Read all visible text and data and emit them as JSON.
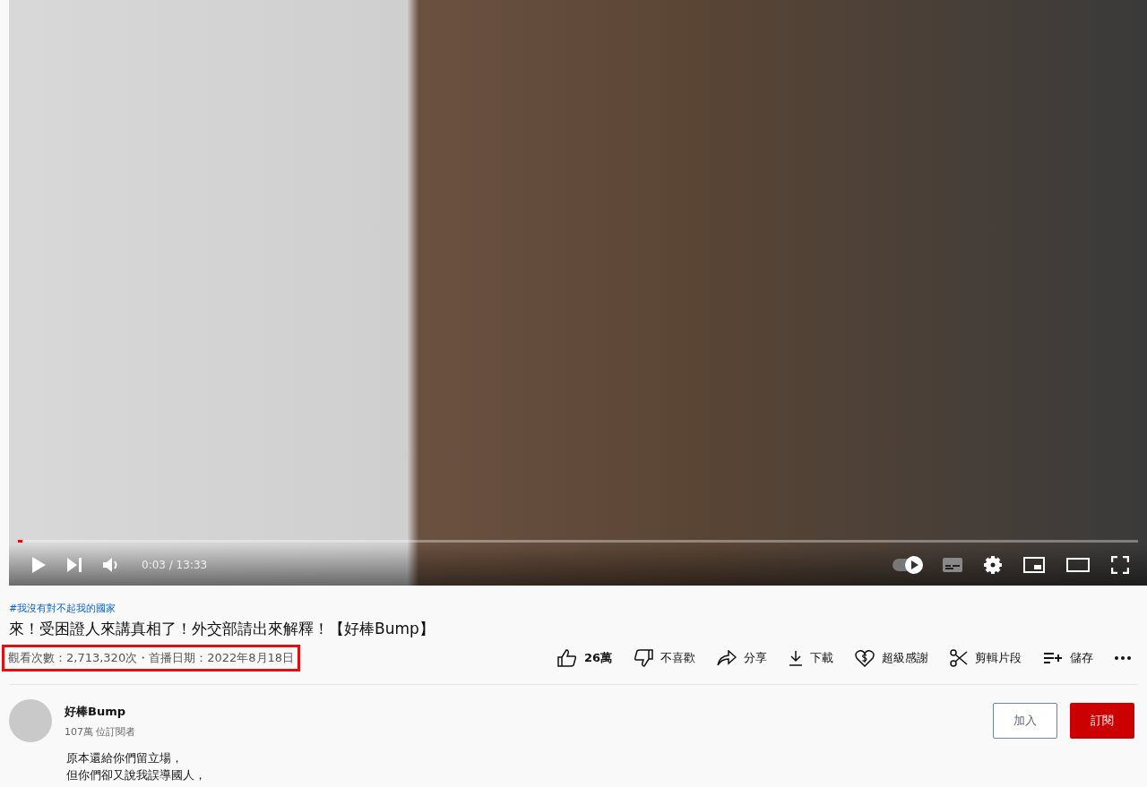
{
  "player": {
    "progress": {
      "level": 0.004
    },
    "time": "0:03 / 13:33",
    "autoplay": {
      "on": true
    },
    "captions": {
      "on": false
    }
  },
  "video": {
    "hashtag": "#我沒有對不起我的國家",
    "title": "來！受困證人來講真相了！外交部請出來解釋！【好棒Bump】",
    "stats": "觀看次數：2,713,320次・首播日期：2022年8月18日",
    "stats_highlighted": true
  },
  "actions": [
    {
      "kind": "like",
      "label": "26萬"
    },
    {
      "kind": "dislike",
      "label": "不喜歡"
    },
    {
      "kind": "share",
      "label": "分享"
    },
    {
      "kind": "download",
      "label": "下載"
    },
    {
      "kind": "thanks",
      "label": "超級感謝"
    },
    {
      "kind": "clip",
      "label": "剪輯片段"
    },
    {
      "kind": "save",
      "label": "儲存"
    },
    {
      "kind": "more"
    }
  ],
  "channel": {
    "name": "好棒Bump",
    "subscribers": "107萬 位訂閱者",
    "join": "加入",
    "subscribe": "訂閱"
  },
  "description": [
    "原本還給你們留立場，",
    "但你們卻又說我誤導國人，"
  ]
}
